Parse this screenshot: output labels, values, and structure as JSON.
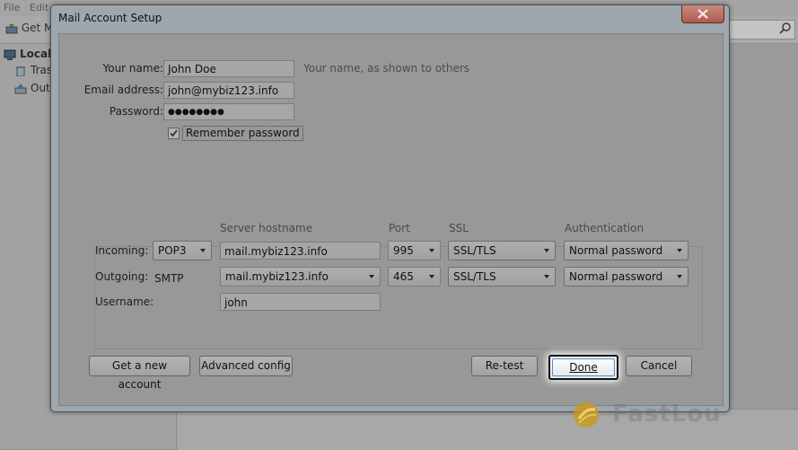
{
  "background": {
    "menu": [
      "File",
      "Edit"
    ],
    "toolbar_get": "Get M",
    "folders": [
      "Local",
      "Tras",
      "Out"
    ]
  },
  "dialog": {
    "title": "Mail Account Setup",
    "name_label": "Your name:",
    "name_value": "John Doe",
    "name_hint": "Your name, as shown to others",
    "email_label": "Email address:",
    "email_value": "john@mybiz123.info",
    "password_label": "Password:",
    "password_value": "●●●●●●●●",
    "remember_label": "Remember password",
    "remember_checked": true,
    "col_server": "Server hostname",
    "col_port": "Port",
    "col_ssl": "SSL",
    "col_auth": "Authentication",
    "incoming_label": "Incoming:",
    "incoming_protocol": "POP3",
    "incoming_server": "mail.mybiz123.info",
    "incoming_port": "995",
    "incoming_ssl": "SSL/TLS",
    "incoming_auth": "Normal password",
    "outgoing_label": "Outgoing:",
    "outgoing_protocol": "SMTP",
    "outgoing_server": "mail.mybiz123.info",
    "outgoing_port": "465",
    "outgoing_ssl": "SSL/TLS",
    "outgoing_auth": "Normal password",
    "username_label": "Username:",
    "username_value": "john",
    "btn_new_account": "Get a new account",
    "btn_advanced": "Advanced config",
    "btn_retest": "Re-test",
    "btn_done": "Done",
    "btn_cancel": "Cancel"
  },
  "watermark": {
    "text": "FastLou"
  },
  "colors": {
    "focus_ring": "#4b8ed6",
    "overlay": "#989898"
  }
}
